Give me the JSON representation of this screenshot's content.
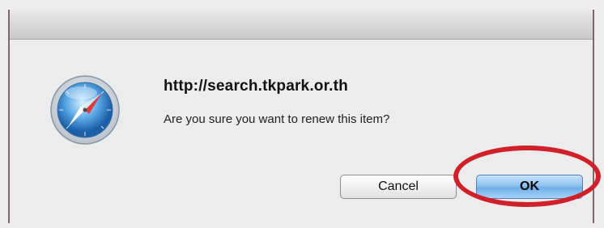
{
  "dialog": {
    "title": "http://search.tkpark.or.th",
    "message": "Are you sure you want to renew this item?",
    "icon": "safari-compass-icon"
  },
  "buttons": {
    "cancel_label": "Cancel",
    "ok_label": "OK"
  },
  "annotation": {
    "highlight_color": "#d0202a",
    "highlight_target": "ok-button"
  },
  "colors": {
    "ok_button_blue": "#6eaee9",
    "titlebar_gray": "#c9c9c9"
  }
}
